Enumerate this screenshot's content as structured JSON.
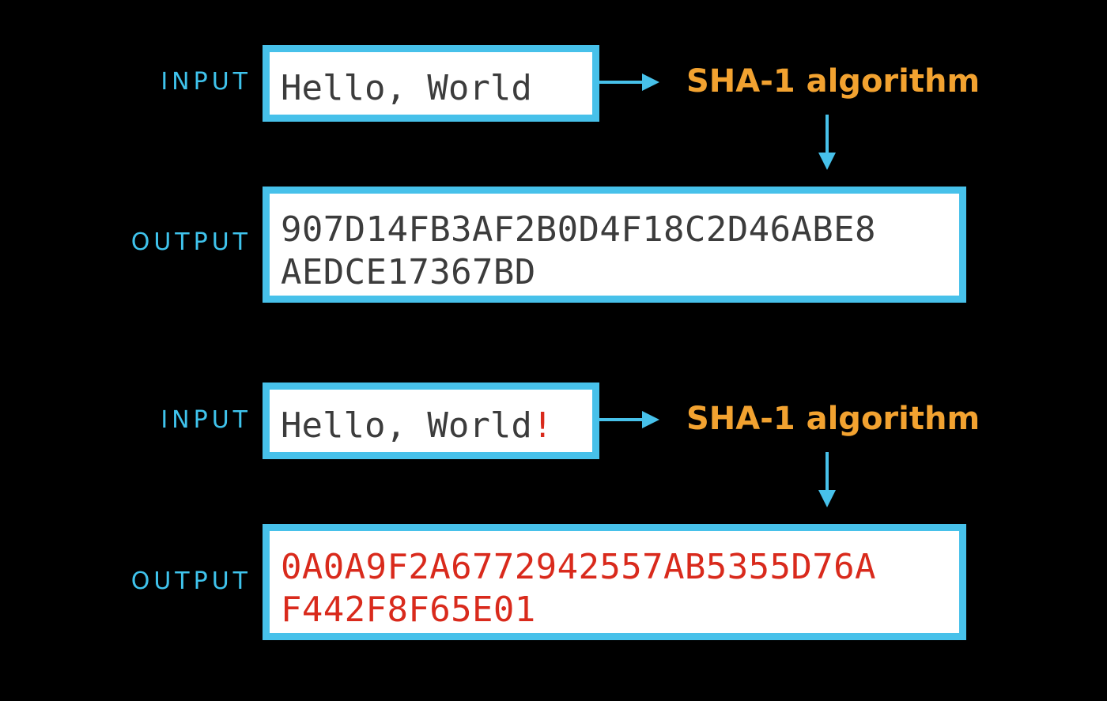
{
  "colors": {
    "background": "#000000",
    "label": "#3fc3ec",
    "box_border": "#47c1ea",
    "arrow": "#47c1ea",
    "algorithm": "#f2a230",
    "text": "#3c3c3c",
    "changed": "#d92a1c"
  },
  "example1": {
    "input_label": "INPUT",
    "input_text": "Hello, World",
    "algorithm": "SHA-1 algorithm",
    "output_label": "OUTPUT",
    "output_line1": "907D14FB3AF2B0D4F18C2D46ABE8",
    "output_line2": "AEDCE17367BD"
  },
  "example2": {
    "input_label": "INPUT",
    "input_text": "Hello, World",
    "input_changed_char": "!",
    "algorithm": "SHA-1 algorithm",
    "output_label": "OUTPUT",
    "output_line1": "0A0A9F2A6772942557AB5355D76A",
    "output_line2": "F442F8F65E01"
  }
}
